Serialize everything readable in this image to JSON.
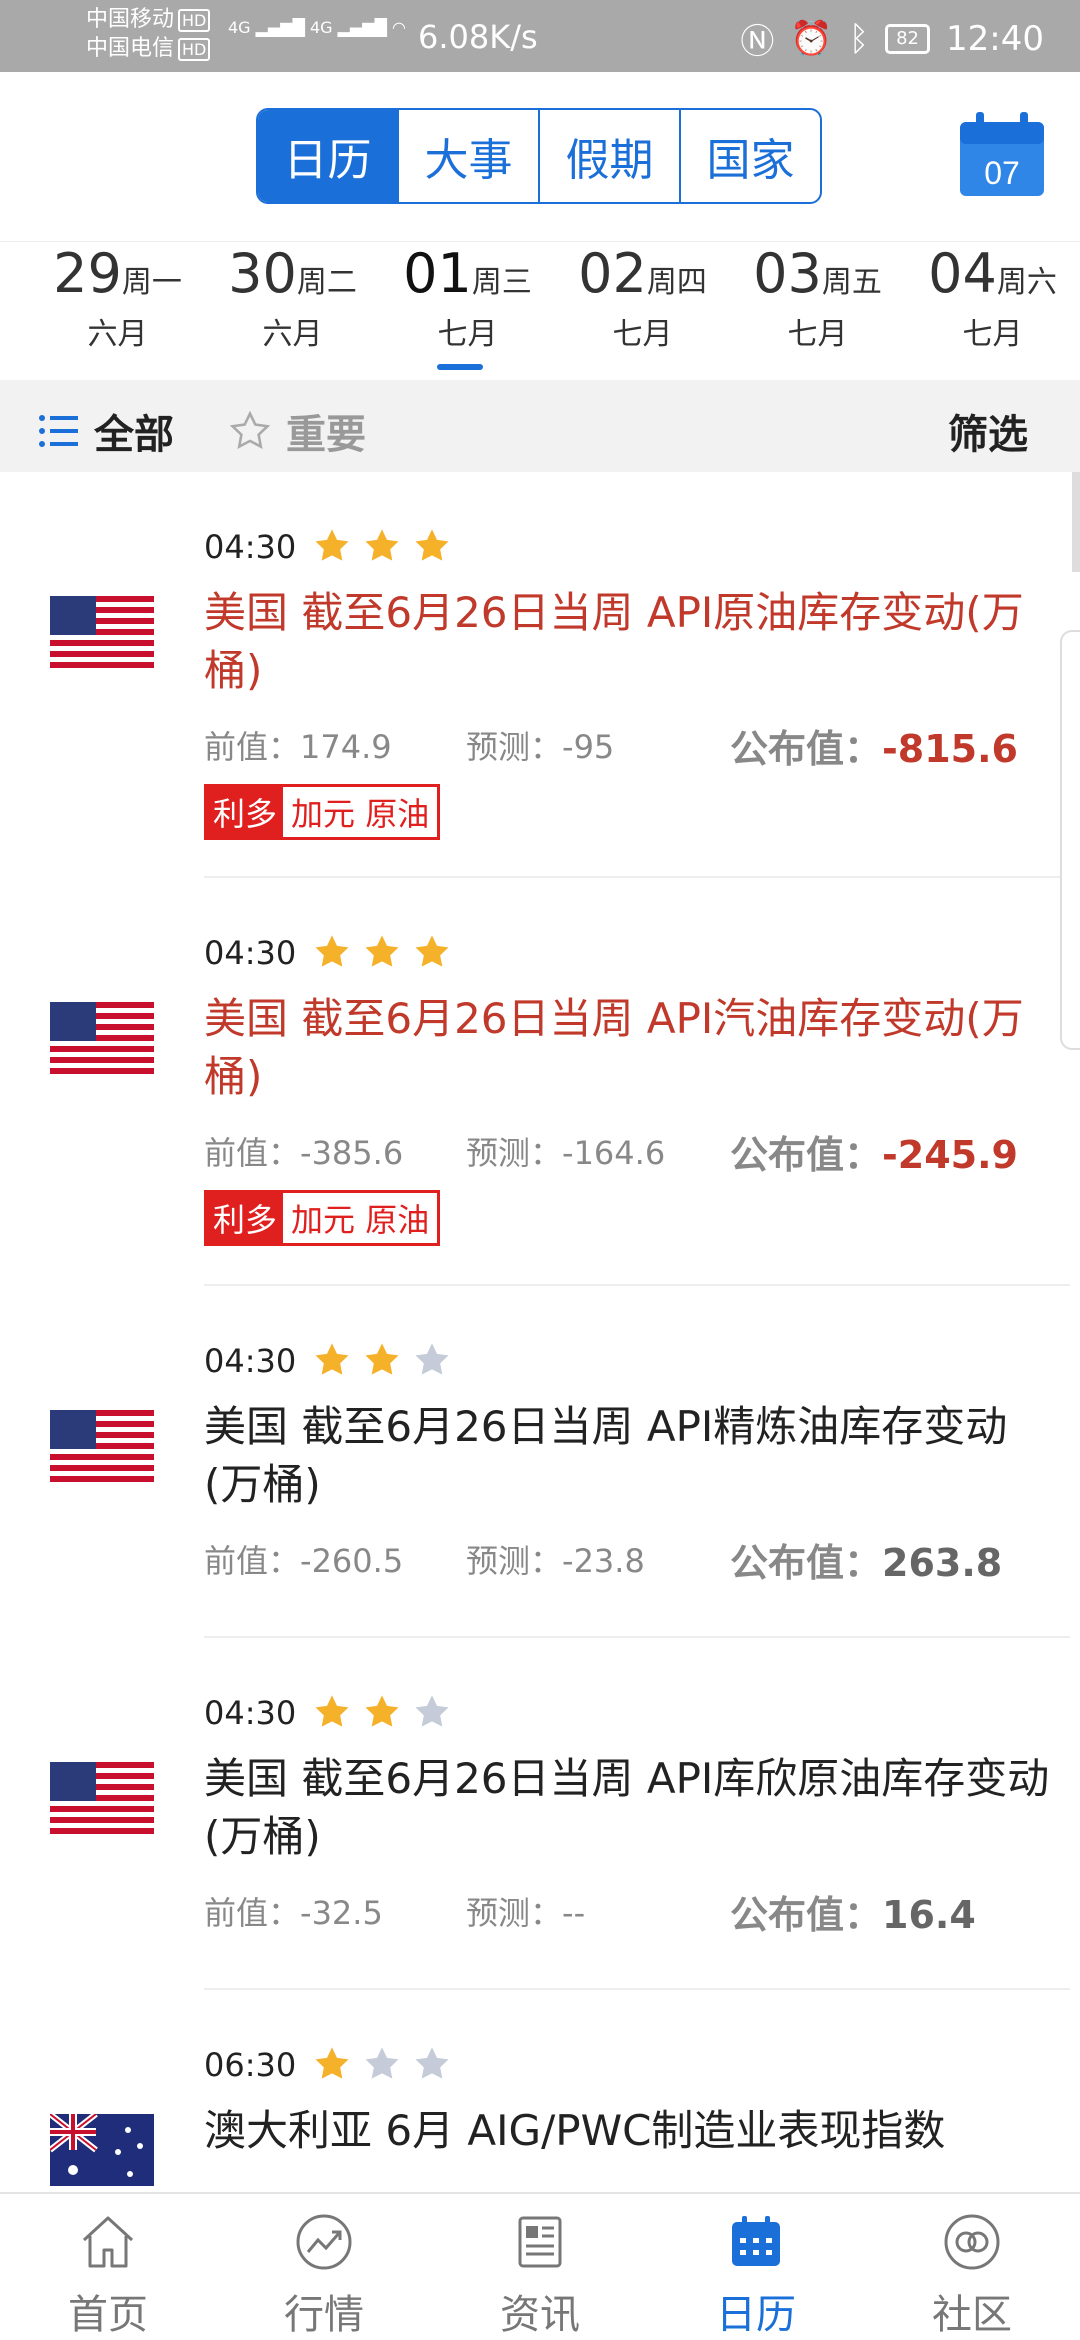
{
  "status_bar": {
    "carrier1": "中国移动",
    "carrier2": "中国电信",
    "hd": "HD",
    "net1": "4G",
    "net2": "4G",
    "speed": "6.08K/s",
    "battery": "82",
    "time": "12:40"
  },
  "header": {
    "tabs": [
      "日历",
      "大事",
      "假期",
      "国家"
    ],
    "active_tab": 0,
    "calendar_day": "07"
  },
  "dates": [
    {
      "num": "29",
      "week": "周一",
      "month": "六月"
    },
    {
      "num": "30",
      "week": "周二",
      "month": "六月"
    },
    {
      "num": "01",
      "week": "周三",
      "month": "七月"
    },
    {
      "num": "02",
      "week": "周四",
      "month": "七月"
    },
    {
      "num": "03",
      "week": "周五",
      "month": "七月"
    },
    {
      "num": "04",
      "week": "周六",
      "month": "七月"
    }
  ],
  "filter_bar": {
    "all_label": "全部",
    "important_label": "重要",
    "filter_label": "筛选"
  },
  "labels": {
    "prev": "前值：",
    "forecast": "预测：",
    "actual": "公布值："
  },
  "events": [
    {
      "time": "04:30",
      "stars": 3,
      "country": "US",
      "title": "美国 截至6月26日当周 API原油库存变动(万桶)",
      "prev": "174.9",
      "forecast": "-95",
      "actual": "-815.6",
      "highlight": true,
      "tag_main": "利多",
      "tag_sub": "加元 原油"
    },
    {
      "time": "04:30",
      "stars": 3,
      "country": "US",
      "title": "美国 截至6月26日当周 API汽油库存变动(万桶)",
      "prev": "-385.6",
      "forecast": "-164.6",
      "actual": "-245.9",
      "highlight": true,
      "tag_main": "利多",
      "tag_sub": "加元 原油"
    },
    {
      "time": "04:30",
      "stars": 2,
      "country": "US",
      "title": "美国 截至6月26日当周 API精炼油库存变动(万桶)",
      "prev": "-260.5",
      "forecast": "-23.8",
      "actual": "263.8",
      "highlight": false
    },
    {
      "time": "04:30",
      "stars": 2,
      "country": "US",
      "title": "美国 截至6月26日当周 API库欣原油库存变动(万桶)",
      "prev": "-32.5",
      "forecast": "--",
      "actual": "16.4",
      "highlight": false
    },
    {
      "time": "06:30",
      "stars": 1,
      "country": "AU",
      "title": "澳大利亚 6月 AIG/PWC制造业表现指数",
      "highlight": false
    }
  ],
  "bottom_nav": [
    {
      "label": "首页",
      "icon": "home-icon"
    },
    {
      "label": "行情",
      "icon": "chart-icon"
    },
    {
      "label": "资讯",
      "icon": "news-icon"
    },
    {
      "label": "日历",
      "icon": "calendar-icon"
    },
    {
      "label": "社区",
      "icon": "community-icon"
    }
  ],
  "active_nav": 3,
  "colors": {
    "accent": "#1a6fd8",
    "highlight_red": "#c0392b",
    "tag_red": "#e0201f",
    "star_gold": "#f5b12a",
    "star_gray": "#c5cbd8"
  }
}
